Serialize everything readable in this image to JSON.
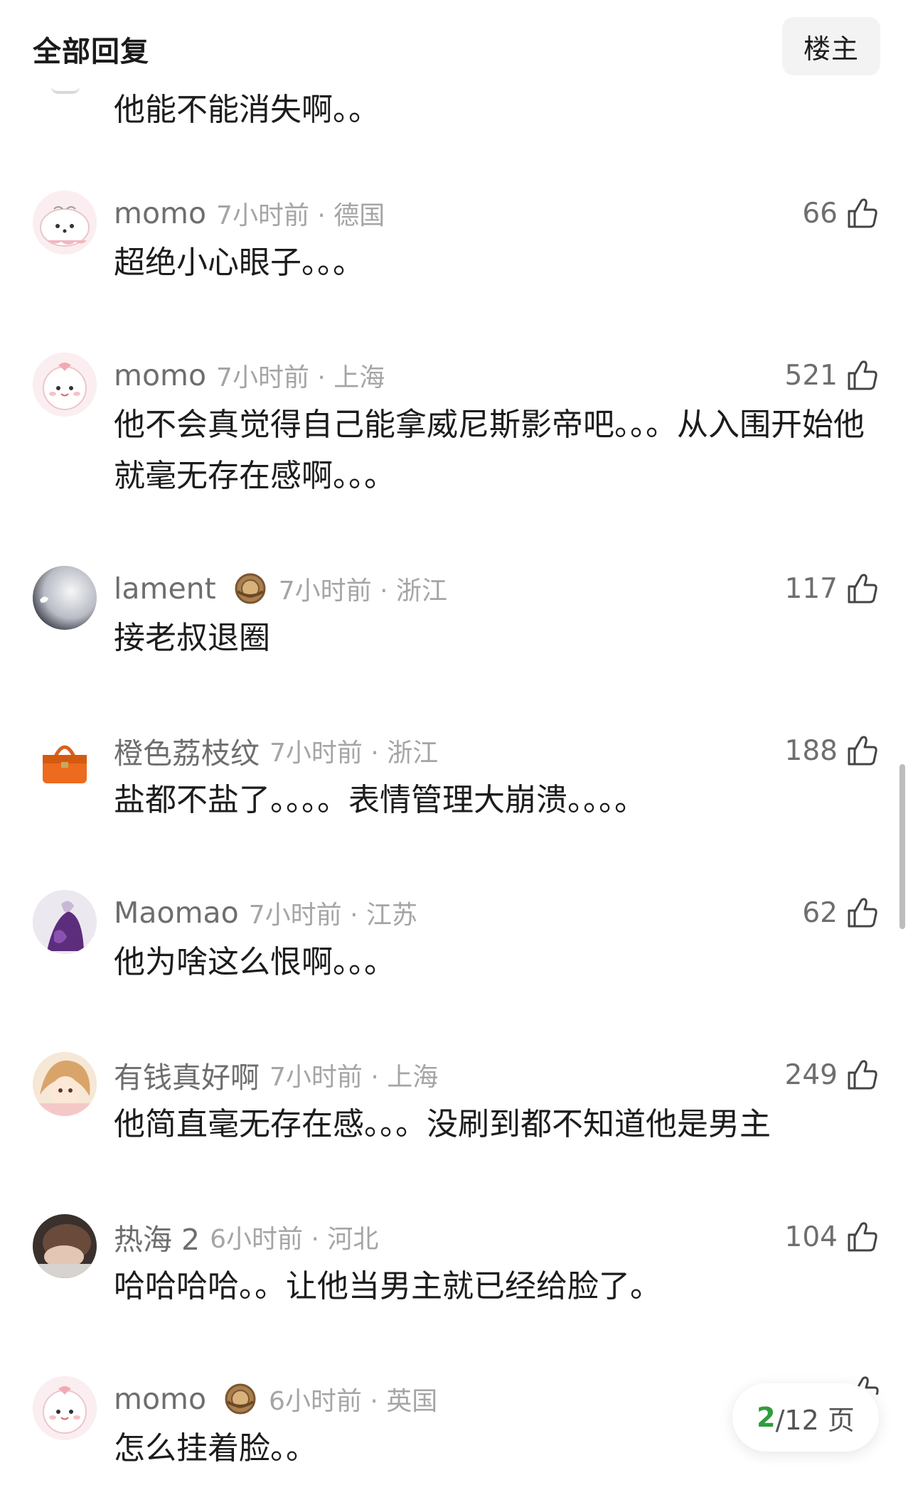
{
  "header": {
    "title": "全部回复",
    "op_button": "楼主"
  },
  "top_partial_reply": "他能不能消失啊。。",
  "comments": [
    {
      "username": "momo",
      "time": "7小时前 · 德国",
      "likes": "66",
      "text": "超绝小心眼子。。。"
    },
    {
      "username": "momo",
      "time": "7小时前 · 上海",
      "likes": "521",
      "text": "他不会真觉得自己能拿威尼斯影帝吧。。。从入围开始他就毫无存在感啊。。。"
    },
    {
      "username": "lament",
      "time": "7小时前 · 浙江",
      "likes": "117",
      "text": "接老叔退圈"
    },
    {
      "username": "橙色荔枝纹",
      "time": "7小时前 · 浙江",
      "likes": "188",
      "text": "盐都不盐了。。。。表情管理大崩溃。。。。"
    },
    {
      "username": "Maomao",
      "time": "7小时前 · 江苏",
      "likes": "62",
      "text": "他为啥这么恨啊。。。"
    },
    {
      "username": "有钱真好啊",
      "time": "7小时前 · 上海",
      "likes": "249",
      "text": "他简直毫无存在感。。。没刷到都不知道他是男主"
    },
    {
      "username": "热海 2",
      "time": "6小时前 · 河北",
      "likes": "104",
      "text": "哈哈哈哈。。让他当男主就已经给脸了。"
    },
    {
      "username": "momo",
      "time": "6小时前 · 英国",
      "likes": "",
      "text": "怎么挂着脸。。"
    }
  ],
  "pager": {
    "current": "2",
    "total_text": "/12 页"
  },
  "colors": {
    "pager_current": "#2e9d3c",
    "meta_text": "#a5a5a5",
    "username": "#6e6e6e"
  },
  "icons": [
    "thumbs-up-icon",
    "medal-icon",
    "avatar-image"
  ]
}
